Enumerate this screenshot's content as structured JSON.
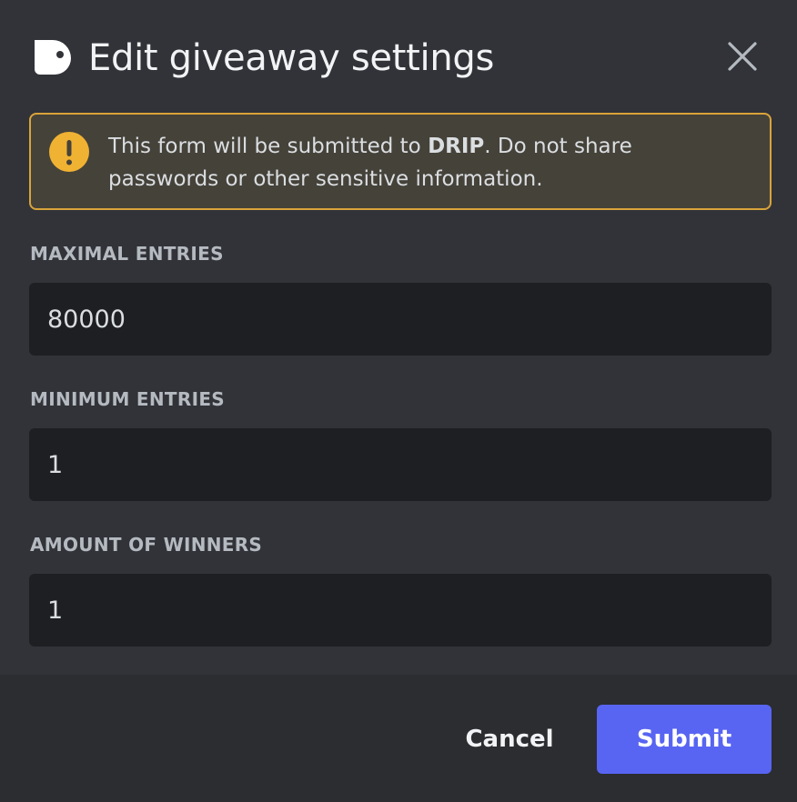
{
  "dialog": {
    "title": "Edit giveaway settings",
    "app_icon": "drip-app-icon",
    "close_icon": "close-icon"
  },
  "warning": {
    "icon": "exclamation-icon",
    "text_prefix": "This form will be submitted to ",
    "app_name": "DRIP",
    "text_suffix": ". Do not share passwords or other sensitive information.",
    "accent_color": "#f0b232"
  },
  "fields": [
    {
      "label": "MAXIMAL ENTRIES",
      "value": "80000"
    },
    {
      "label": "MINIMUM ENTRIES",
      "value": "1"
    },
    {
      "label": "AMOUNT OF WINNERS",
      "value": "1"
    }
  ],
  "footer": {
    "cancel_label": "Cancel",
    "submit_label": "Submit",
    "submit_color": "#5865f2"
  }
}
